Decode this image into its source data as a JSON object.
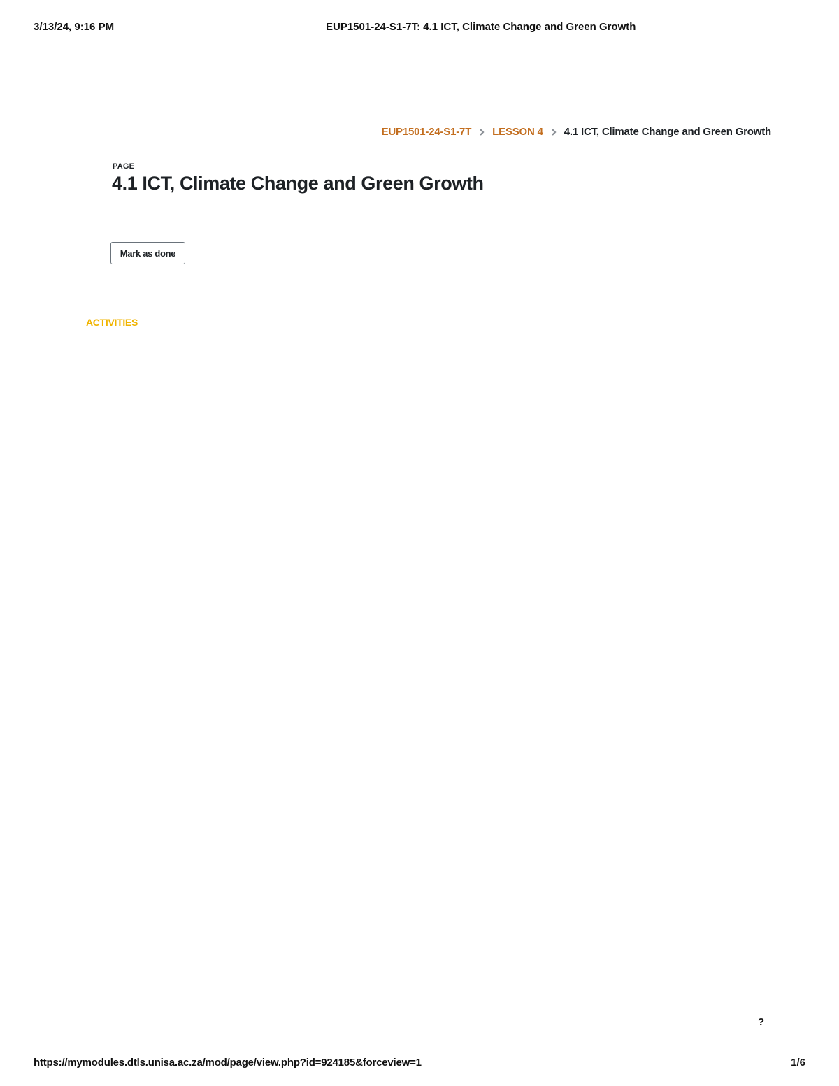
{
  "print_header": {
    "datetime": "3/13/24, 9:16 PM",
    "title": "EUP1501-24-S1-7T: 4.1 ICT, Climate Change and Green Growth"
  },
  "breadcrumb": {
    "items": [
      {
        "label": "EUP1501-24-S1-7T",
        "link": true
      },
      {
        "label": "LESSON 4",
        "link": true
      },
      {
        "label": "4.1 ICT, Climate Change and Green Growth",
        "link": false
      }
    ],
    "separator_icon": "chevron-right-icon"
  },
  "page": {
    "type_label": "PAGE",
    "heading": "4.1 ICT, Climate Change and Green Growth",
    "mark_done_label": "Mark as done"
  },
  "activities_label": "ACTIVITIES",
  "help_icon": "?",
  "print_footer": {
    "url": "https://mymodules.dtls.unisa.ac.za/mod/page/view.php?id=924185&forceview=1",
    "page_number": "1/6"
  },
  "colors": {
    "link": "#c36e1f",
    "activities": "#f0b400",
    "text": "#1d2125"
  }
}
